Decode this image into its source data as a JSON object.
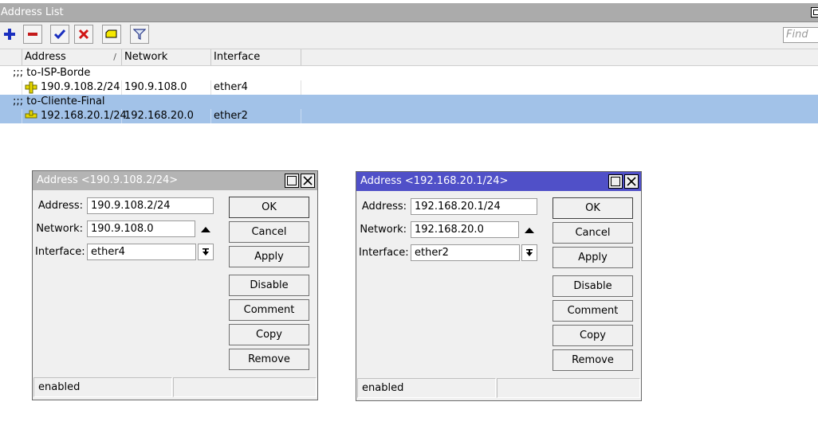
{
  "window": {
    "title": "Address List"
  },
  "toolbar": {
    "add": "add-icon",
    "remove": "remove-icon",
    "enable": "check-icon",
    "disable": "x-icon",
    "comment": "comment-icon",
    "filter": "filter-icon",
    "find_placeholder": "Find"
  },
  "table": {
    "columns": [
      "Address",
      "Network",
      "Interface"
    ],
    "groups": [
      {
        "comment": ";;; to-ISP-Borde",
        "address": "190.9.108.2/24",
        "network": "190.9.108.0",
        "interface": "ether4",
        "selected": false
      },
      {
        "comment": ";;; to-Cliente-Final",
        "address": "192.168.20.1/24",
        "network": "192.168.20.0",
        "interface": "ether2",
        "selected": true
      }
    ]
  },
  "dialogs": [
    {
      "title": "Address <190.9.108.2/24>",
      "active": false,
      "labels": {
        "address": "Address:",
        "network": "Network:",
        "interface": "Interface:"
      },
      "values": {
        "address": "190.9.108.2/24",
        "network": "190.9.108.0",
        "interface": "ether4"
      },
      "buttons": [
        "OK",
        "Cancel",
        "Apply",
        "Disable",
        "Comment",
        "Copy",
        "Remove"
      ],
      "status": "enabled"
    },
    {
      "title": "Address <192.168.20.1/24>",
      "active": true,
      "labels": {
        "address": "Address:",
        "network": "Network:",
        "interface": "Interface:"
      },
      "values": {
        "address": "192.168.20.1/24",
        "network": "192.168.20.0",
        "interface": "ether2"
      },
      "buttons": [
        "OK",
        "Cancel",
        "Apply",
        "Disable",
        "Comment",
        "Copy",
        "Remove"
      ],
      "status": "enabled"
    }
  ],
  "colors": {
    "title_inactive": "#b4b4b4",
    "title_active": "#5050c8",
    "selection": "#a2c2e8"
  }
}
